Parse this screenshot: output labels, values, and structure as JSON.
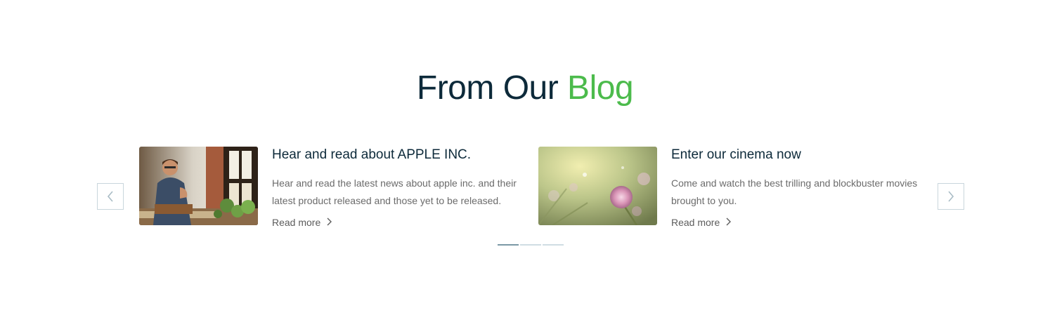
{
  "section": {
    "title_main": "From Our ",
    "title_accent": "Blog",
    "accent_color": "#4cbb4c",
    "title_color": "#0d2a3a"
  },
  "carousel": {
    "prev_icon": "chevron-left-icon",
    "next_icon": "chevron-right-icon",
    "active_dot": 1,
    "dot_count": 3
  },
  "posts": [
    {
      "title": "Hear and read about APPLE INC.",
      "excerpt": "Hear and read the latest news about apple inc. and their latest product released and those yet to be released.",
      "read_more": "Read more",
      "image": "man-at-workbench-photo"
    },
    {
      "title": "Enter our cinema now",
      "excerpt": "Come and watch the best trilling and blockbuster movies brought to you.",
      "read_more": "Read more",
      "image": "pink-flower-photo"
    }
  ]
}
